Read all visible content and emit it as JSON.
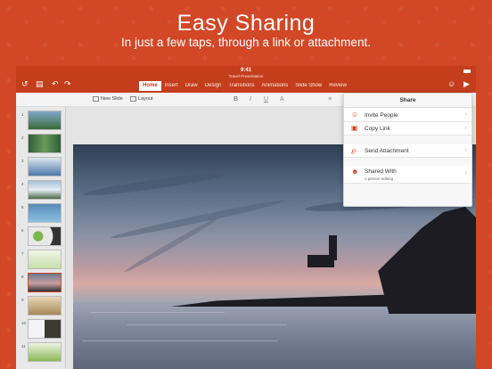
{
  "promo": {
    "headline": "Easy Sharing",
    "subhead": "In just a few taps, through a link or attachment."
  },
  "status": {
    "time": "9:41",
    "doc_title": "Travel Presentation"
  },
  "ribbon": {
    "tabs": [
      {
        "label": "Home",
        "active": true
      },
      {
        "label": "Insert"
      },
      {
        "label": "Draw"
      },
      {
        "label": "Design"
      },
      {
        "label": "Transitions"
      },
      {
        "label": "Animations"
      },
      {
        "label": "Slide Show"
      },
      {
        "label": "Review"
      }
    ]
  },
  "toolbar": {
    "new_slide": "New Slide",
    "layout": "Layout",
    "bold": "B",
    "italic": "I",
    "underline": "U",
    "font_color": "A"
  },
  "thumbnails": [
    "1",
    "2",
    "3",
    "4",
    "5",
    "6",
    "7",
    "8",
    "9",
    "10",
    "11"
  ],
  "share": {
    "title": "Share",
    "invite": "Invite People",
    "copy_link": "Copy Link",
    "send_attachment": "Send Attachment",
    "shared_with": "Shared With",
    "shared_with_sub": "1 person editing"
  },
  "colors": {
    "brand": "#d24726",
    "ribbon": "#c43e1c"
  }
}
